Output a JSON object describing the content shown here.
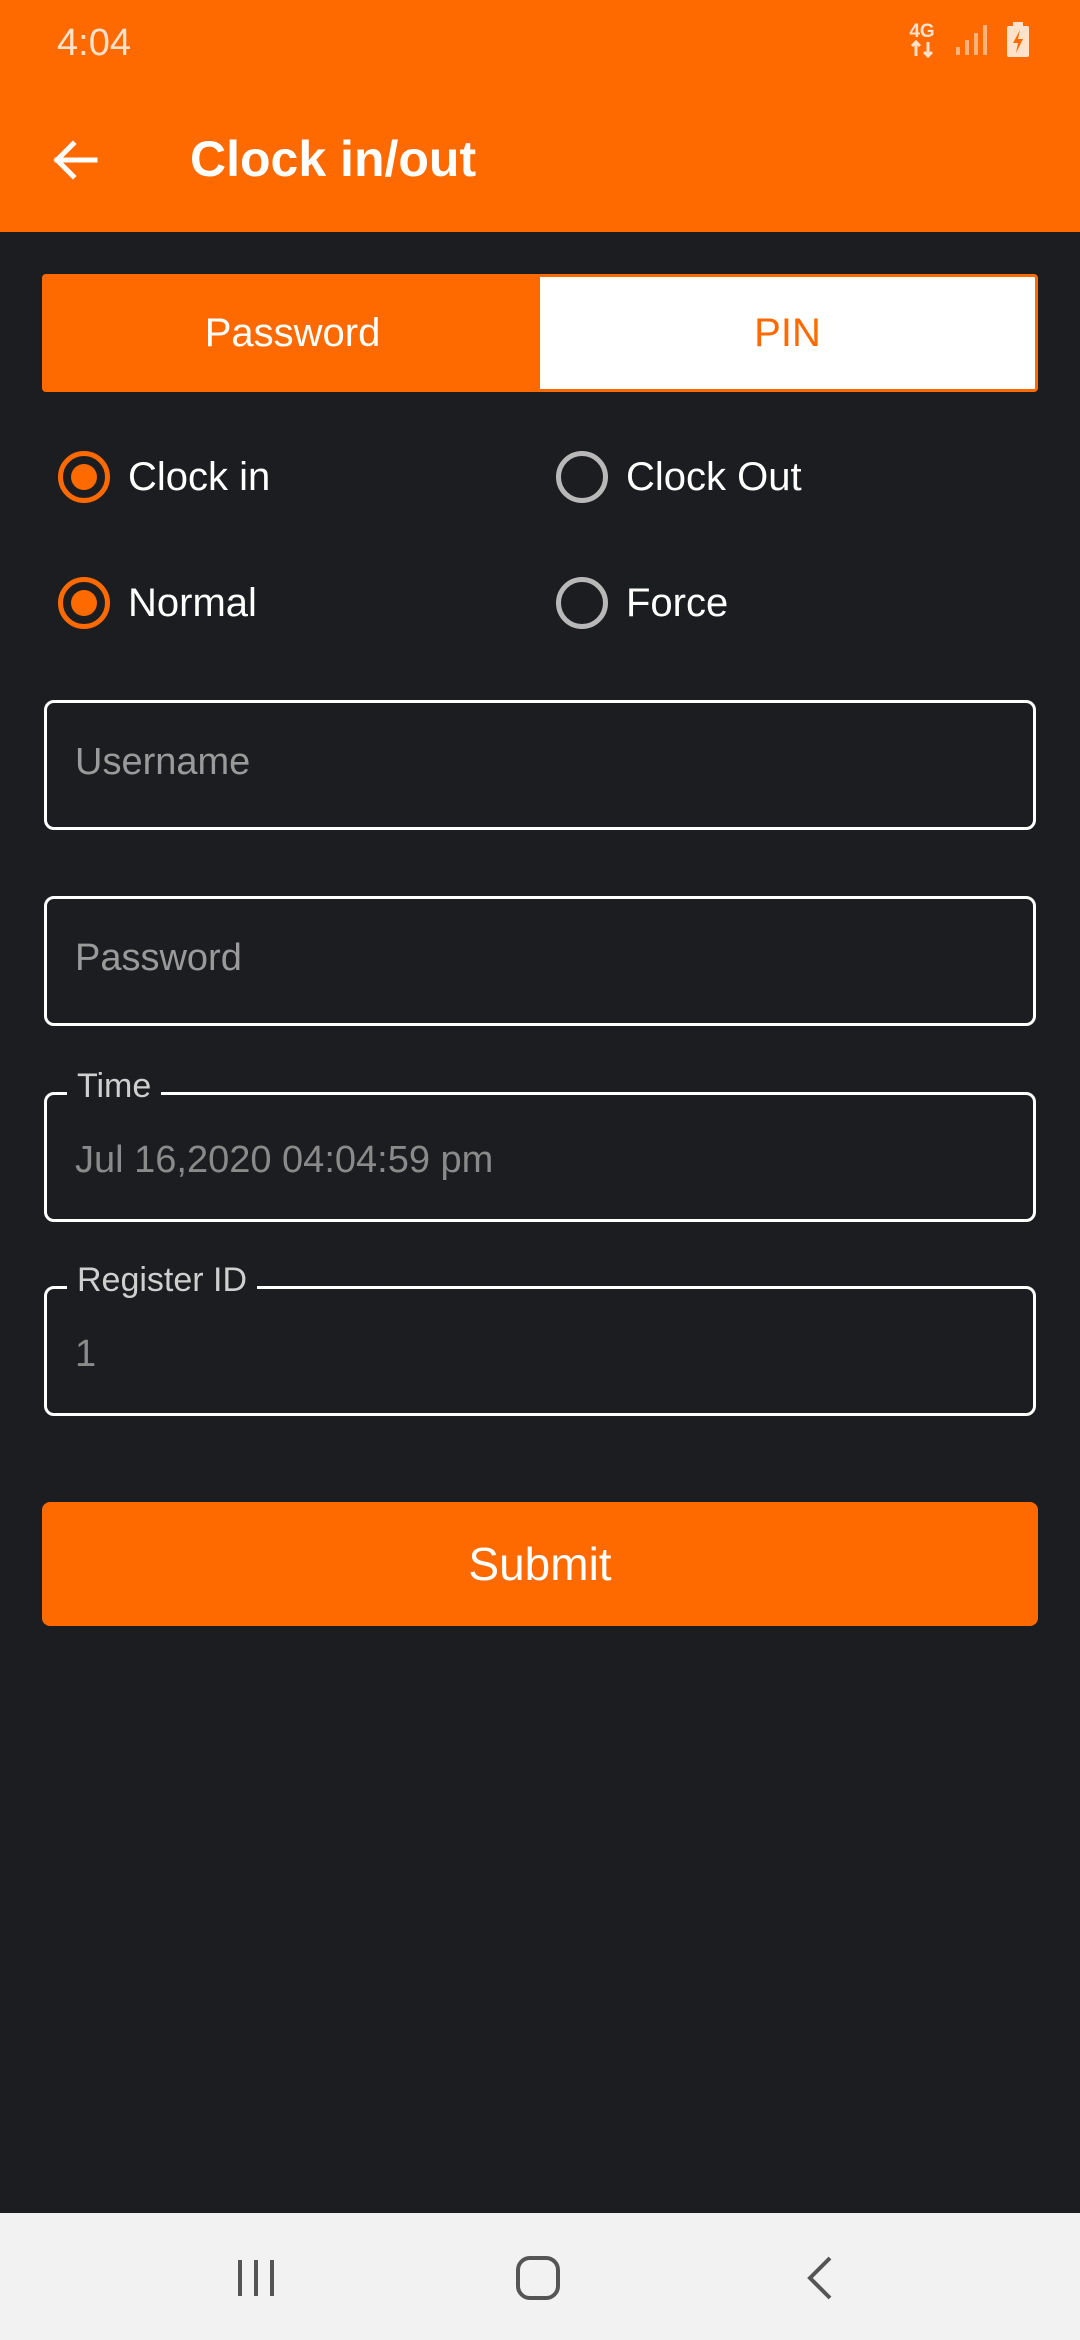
{
  "status_bar": {
    "time": "4:04",
    "network": "4G",
    "icons": [
      "network-4g-icon",
      "signal-icon",
      "battery-charging-icon"
    ]
  },
  "app_bar": {
    "title": "Clock in/out",
    "back_icon": "arrow-back-icon"
  },
  "auth_tabs": [
    {
      "label": "Password",
      "selected": true
    },
    {
      "label": "PIN",
      "selected": false
    }
  ],
  "clock_options": [
    {
      "label": "Clock in",
      "selected": true
    },
    {
      "label": "Clock Out",
      "selected": false
    }
  ],
  "mode_options": [
    {
      "label": "Normal",
      "selected": true
    },
    {
      "label": "Force",
      "selected": false
    }
  ],
  "fields": {
    "username": {
      "placeholder": "Username",
      "value": ""
    },
    "password": {
      "placeholder": "Password",
      "value": ""
    },
    "time": {
      "label": "Time",
      "value": "Jul 16,2020 04:04:59 pm"
    },
    "register_id": {
      "label": "Register ID",
      "value": "1"
    }
  },
  "submit_label": "Submit",
  "nav_bar": [
    "recent-apps-icon",
    "home-icon",
    "back-icon"
  ],
  "colors": {
    "accent": "#ff6a00",
    "background": "#1c1d21",
    "navbar": "#f2f2f2"
  }
}
